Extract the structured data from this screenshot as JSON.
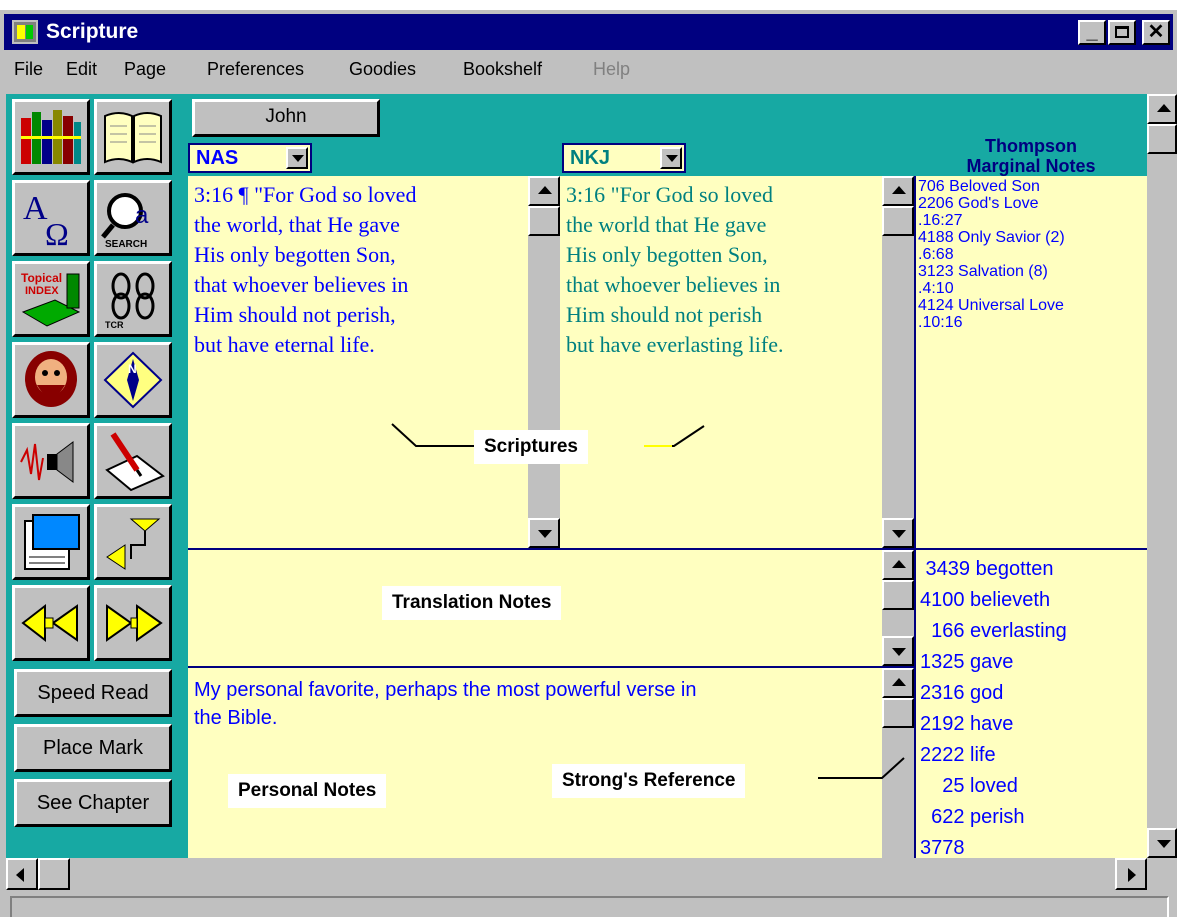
{
  "window": {
    "title": "Scripture"
  },
  "menu": [
    {
      "label": "File",
      "enabled": true
    },
    {
      "label": "Edit",
      "enabled": true
    },
    {
      "label": "Page",
      "enabled": true
    },
    {
      "label": "Preferences",
      "enabled": true
    },
    {
      "label": "Goodies",
      "enabled": true
    },
    {
      "label": "Bookshelf",
      "enabled": true
    },
    {
      "label": "Help",
      "enabled": false
    }
  ],
  "toolbar": {
    "icons": [
      "bookshelf-icon",
      "open-bible-icon",
      "alpha-omega-icon",
      "search-icon",
      "topical-index-icon",
      "tcr-chain-icon",
      "bearded-man-icon",
      "compass-icon",
      "speaker-icon",
      "pen-note-icon",
      "notepad-icon",
      "step-arrow-icon",
      "previous-arrow-icon",
      "next-arrow-icon"
    ],
    "search_label": "SEARCH",
    "topical_label_1": "Topical",
    "topical_label_2": "INDEX",
    "tcr_label": "TCR",
    "speed_read": "Speed Read",
    "place_mark": "Place Mark",
    "see_chapter": "See Chapter"
  },
  "book": "John",
  "translations": {
    "left": "NAS",
    "right": "NKJ"
  },
  "marginal_heading_1": "Thompson",
  "marginal_heading_2": "Marginal Notes",
  "nas_verse": [
    "3:16 ¶ \"For God so loved",
    "the world, that He gave",
    "His only begotten Son,",
    "that whoever believes in",
    "Him should not perish,",
    "but have eternal life."
  ],
  "nkj_verse": [
    "3:16 \"For God so loved",
    "the world that He gave",
    "His only begotten Son,",
    "that whoever believes in",
    "Him should not perish",
    "but have everlasting life."
  ],
  "thompson_notes": [
    "706 Beloved Son",
    "2206 God's Love",
    ".16:27",
    "4188 Only Savior (2)",
    ".6:68",
    "3123 Salvation (8)",
    ".4:10",
    "4124 Universal Love",
    ".10:16"
  ],
  "strongs": [
    " 3439 begotten",
    "4100 believeth",
    "  166 everlasting",
    "1325 gave",
    "2316 god",
    "2192 have",
    "2222 life",
    "    25 loved",
    "  622 perish",
    "3778"
  ],
  "personal_note": [
    "My personal favorite, perhaps the most powerful verse in",
    "the Bible."
  ],
  "callouts": {
    "scriptures": "Scriptures",
    "translation_notes": "Translation Notes",
    "personal_notes": "Personal Notes",
    "strongs_reference": "Strong's Reference"
  },
  "colors": {
    "teal": "#17a9a3",
    "pane": "#ffffc0",
    "title": "#000080",
    "nas_text": "#0000ff",
    "nkj_text": "#008080"
  }
}
